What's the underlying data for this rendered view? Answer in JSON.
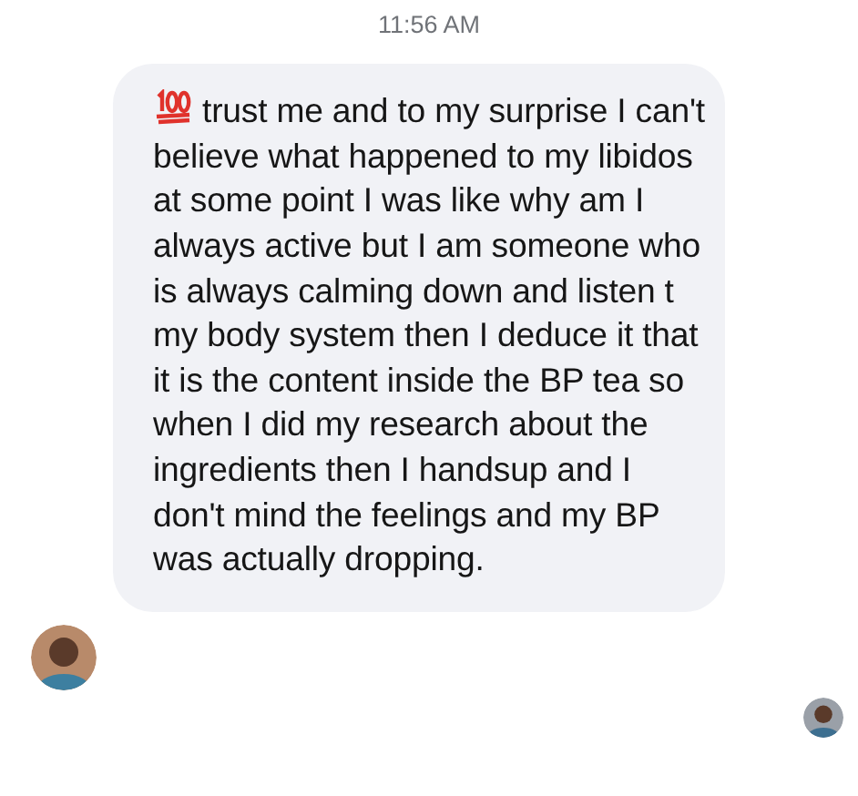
{
  "timestamp": "11:56 AM",
  "message": {
    "text": "trust me and to my surprise I can't believe what happened to my libidos at some point I was like why am I always active but I am someone who is always calming down and listen t my body system then I deduce it that it is the content inside the BP tea so when I did my research about the ingredients then I handsup and I don't mind the feelings and my BP was actually dropping."
  }
}
